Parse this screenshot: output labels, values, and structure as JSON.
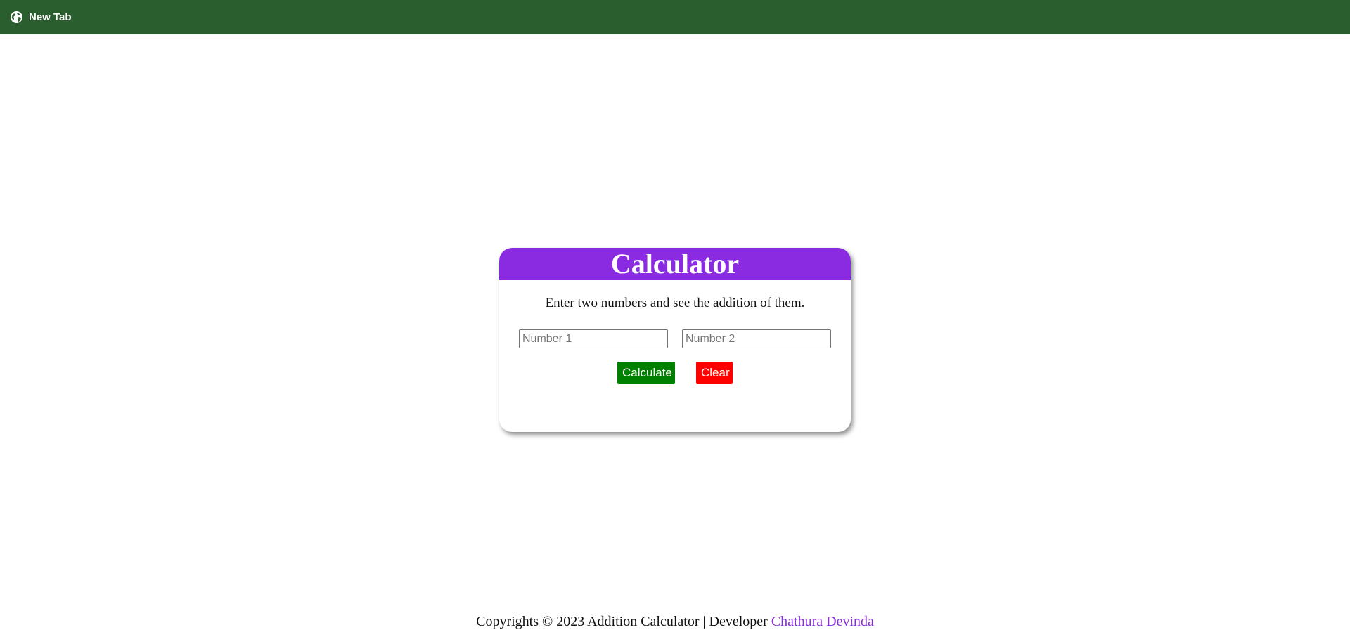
{
  "tab": {
    "title": "New Tab",
    "icon": "globe-icon"
  },
  "colors": {
    "topbar": "#2a5e2e",
    "header": "#8a2be2",
    "calculate_button": "#008000",
    "clear_button": "#ff0000",
    "link": "#8a2be2"
  },
  "calculator": {
    "title": "Calculator",
    "instruction": "Enter two numbers and see the addition of them.",
    "number1_placeholder": "Number 1",
    "number1_value": "",
    "number2_placeholder": "Number 2",
    "number2_value": "",
    "calculate_label": "Calculate",
    "clear_label": "Clear"
  },
  "footer": {
    "text": "Copyrights © 2023 Addition Calculator | Developer",
    "developer_name": "Chathura Devinda"
  }
}
